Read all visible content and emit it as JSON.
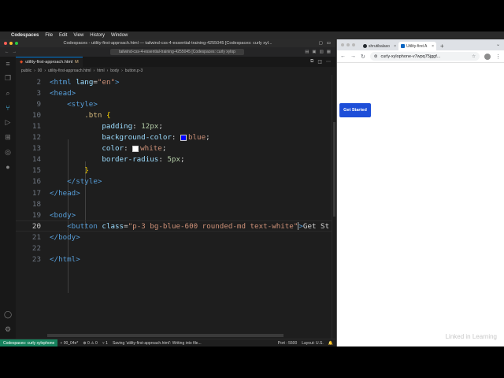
{
  "menubar": {
    "app": "Codespaces",
    "items": [
      "File",
      "Edit",
      "View",
      "History",
      "Window"
    ]
  },
  "vscode": {
    "window_title": "Codespaces - utility-first-approach.html — tailwind-css-4-essential-training-4255045 [Codespaces: curly xyl...",
    "command_center": "tailwind-css-4-essential-training-4255045 [Codespaces: curly xylop",
    "editor_tab": {
      "label": "utility-first-approach.html",
      "badge": "M"
    },
    "breadcrumb": [
      "public",
      "00",
      "utility-first-approach.html",
      "html",
      "body",
      "button.p-3"
    ],
    "active_line": 20,
    "lines": [
      {
        "n": "2",
        "html": "<span class='t-tag'>&lt;html</span> <span class='t-attr'>lang</span><span class='t-txt'>=</span><span class='t-str'>\"en\"</span><span class='t-tag'>&gt;</span>"
      },
      {
        "n": "3",
        "html": "<span class='t-tag'>&lt;head&gt;</span>"
      },
      {
        "n": "9",
        "html": "    <span class='t-tag'>&lt;style&gt;</span>"
      },
      {
        "n": "10",
        "html": "        <span class='t-sel'>.btn</span> <span class='t-brk'>{</span>"
      },
      {
        "n": "11",
        "html": "            <span class='t-prop'>padding</span><span class='t-txt'>: </span><span class='t-num'>12px</span><span class='t-txt'>;</span>"
      },
      {
        "n": "12",
        "html": "            <span class='t-prop'>background-color</span><span class='t-txt'>: </span><span class='swatch sw-blue'></span><span class='t-val'>blue</span><span class='t-txt'>;</span>"
      },
      {
        "n": "13",
        "html": "            <span class='t-prop'>color</span><span class='t-txt'>: </span><span class='swatch sw-white'></span><span class='t-val'>white</span><span class='t-txt'>;</span>"
      },
      {
        "n": "14",
        "html": "            <span class='t-prop'>border-radius</span><span class='t-txt'>: </span><span class='t-num'>5px</span><span class='t-txt'>;</span>"
      },
      {
        "n": "15",
        "html": "        <span class='t-brk'>}</span>"
      },
      {
        "n": "16",
        "html": "    <span class='t-tag'>&lt;/style&gt;</span>"
      },
      {
        "n": "17",
        "html": "<span class='t-tag'>&lt;/head&gt;</span>"
      },
      {
        "n": "18",
        "html": ""
      },
      {
        "n": "19",
        "html": "<span class='t-tag'>&lt;body&gt;</span>"
      },
      {
        "n": "20",
        "html": "    <span class='t-tag'>&lt;button</span> <span class='t-attr'>class</span><span class='t-txt'>=</span><span class='t-str'>\"p-3 bg-blue-600 rounded-md text-white\"</span><span class='caret'></span><span class='t-tag'>&gt;</span><span class='t-txt'>Get St</span>"
      },
      {
        "n": "21",
        "html": "<span class='t-tag'>&lt;/body&gt;</span>"
      },
      {
        "n": "22",
        "html": ""
      },
      {
        "n": "23",
        "html": "<span class='t-tag'>&lt;/html&gt;</span>"
      }
    ],
    "status": {
      "remote": "Codespaces: curly xylophone",
      "branch": "00_04e*",
      "problems": "⊗ 0 ⚠ 0",
      "ports_count": "1",
      "message": "Saving 'utility-first-approach.html': Writing into file...",
      "port": "Port : 5500",
      "layout": "Layout: U.S."
    }
  },
  "chrome": {
    "tabs": [
      {
        "label": "shrutibalaso",
        "favicon_color": "#24292f",
        "active": false
      },
      {
        "label": "Utility-first A",
        "favicon_color": "#0a66c2",
        "active": true
      }
    ],
    "url": "curly-xylophone-v7wpq75jggf...",
    "page": {
      "button_label": "Get Started"
    },
    "watermark": "Linked in Learning"
  }
}
